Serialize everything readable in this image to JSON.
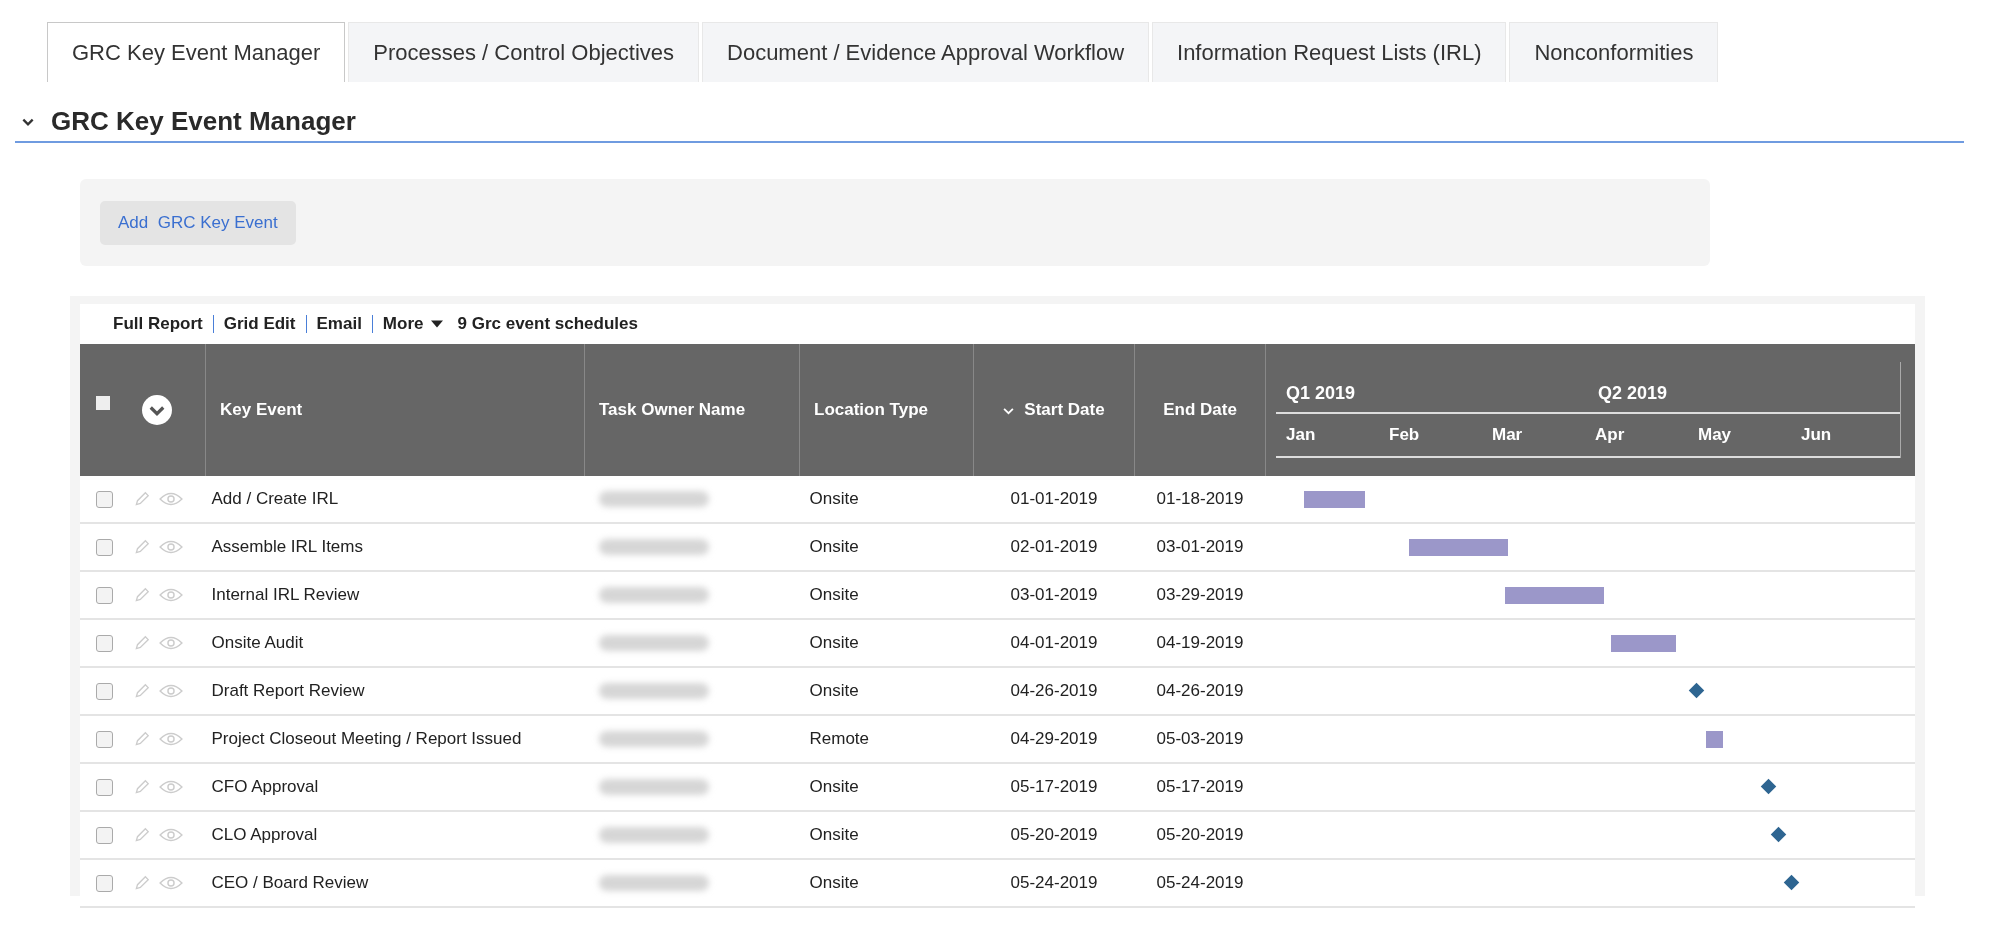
{
  "tabs": [
    {
      "label": "GRC Key Event Manager",
      "selected": true
    },
    {
      "label": "Processes / Control Objectives",
      "selected": false
    },
    {
      "label": "Document / Evidence Approval Workflow",
      "selected": false
    },
    {
      "label": "Information Request Lists (IRL)",
      "selected": false
    },
    {
      "label": "Nonconformities",
      "selected": false
    }
  ],
  "section": {
    "title": "GRC Key Event Manager",
    "expanded": true
  },
  "add_button": "Add  GRC Key Event",
  "toolbar": {
    "links": [
      "Full Report",
      "Grid Edit",
      "Email"
    ],
    "more": "More",
    "count": "9 Grc event schedules"
  },
  "table": {
    "all_checked": false,
    "columns": [
      {
        "label": "Key Event",
        "sorted": false
      },
      {
        "label": "Task Owner Name",
        "sorted": false
      },
      {
        "label": "Location Type",
        "sorted": false
      },
      {
        "label": "Start Date",
        "sorted": true
      },
      {
        "label": "End Date",
        "sorted": false
      }
    ],
    "timeline": {
      "quarters": [
        "Q1 2019",
        "Q2 2019"
      ],
      "months": [
        "Jan",
        "Feb",
        "Mar",
        "Apr",
        "May",
        "Jun"
      ]
    },
    "rows": [
      {
        "checked": false,
        "key_event": "Add / Create IRL",
        "location": "Onsite",
        "start": "01-01-2019",
        "end": "01-18-2019",
        "kind": "bar"
      },
      {
        "checked": false,
        "key_event": "Assemble IRL Items",
        "location": "Onsite",
        "start": "02-01-2019",
        "end": "03-01-2019",
        "kind": "bar"
      },
      {
        "checked": false,
        "key_event": "Internal IRL Review",
        "location": "Onsite",
        "start": "03-01-2019",
        "end": "03-29-2019",
        "kind": "bar"
      },
      {
        "checked": false,
        "key_event": "Onsite Audit",
        "location": "Onsite",
        "start": "04-01-2019",
        "end": "04-19-2019",
        "kind": "bar"
      },
      {
        "checked": false,
        "key_event": "Draft Report Review",
        "location": "Onsite",
        "start": "04-26-2019",
        "end": "04-26-2019",
        "kind": "milestone"
      },
      {
        "checked": false,
        "key_event": "Project Closeout Meeting / Report Issued",
        "location": "Remote",
        "start": "04-29-2019",
        "end": "05-03-2019",
        "kind": "bar"
      },
      {
        "checked": false,
        "key_event": "CFO Approval",
        "location": "Onsite",
        "start": "05-17-2019",
        "end": "05-17-2019",
        "kind": "milestone"
      },
      {
        "checked": false,
        "key_event": "CLO Approval",
        "location": "Onsite",
        "start": "05-20-2019",
        "end": "05-20-2019",
        "kind": "milestone"
      },
      {
        "checked": false,
        "key_event": "CEO / Board Review",
        "location": "Onsite",
        "start": "05-24-2019",
        "end": "05-24-2019",
        "kind": "milestone"
      }
    ]
  }
}
